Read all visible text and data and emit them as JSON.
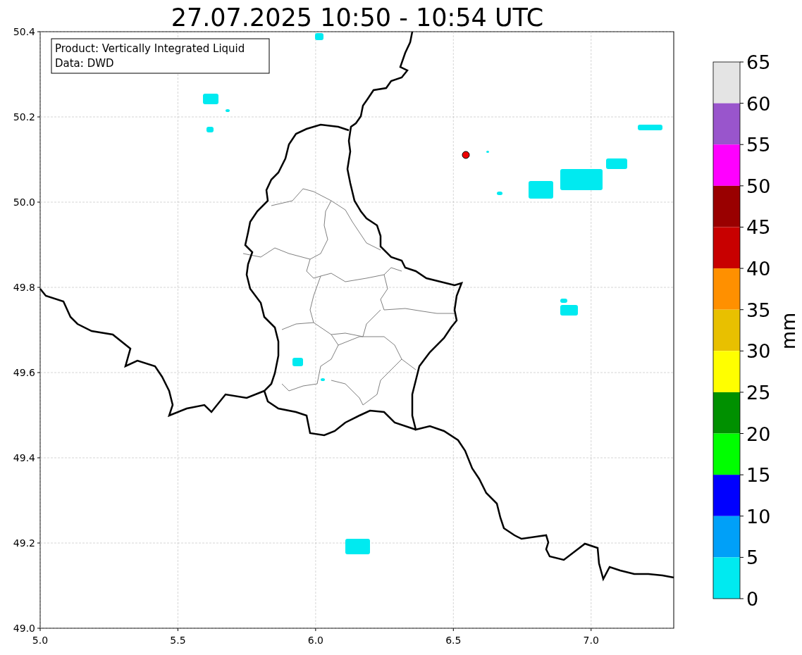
{
  "title": "27.07.2025 10:50 - 10:54 UTC",
  "map": {
    "legend": [
      "Product: Vertically Integrated Liquid",
      "Data: DWD"
    ],
    "xticks": [
      "5.0",
      "5.5",
      "6.0",
      "6.5",
      "7.0"
    ],
    "yticks": [
      "50.4",
      "50.2",
      "50.0",
      "49.8",
      "49.6",
      "49.4",
      "49.2",
      "49.0"
    ]
  },
  "colorbar": {
    "label": "mm",
    "ticks": [
      "65",
      "60",
      "55",
      "50",
      "45",
      "40",
      "35",
      "30",
      "25",
      "20",
      "15",
      "10",
      "5",
      "0"
    ],
    "bins": [
      {
        "color": "#e4e4e4"
      },
      {
        "color": "#9955cc"
      },
      {
        "color": "#ff00ff"
      },
      {
        "color": "#990000"
      },
      {
        "color": "#c80000"
      },
      {
        "color": "#ff9000"
      },
      {
        "color": "#e8c000"
      },
      {
        "color": "#ffff00"
      },
      {
        "color": "#009000"
      },
      {
        "color": "#00ff00"
      },
      {
        "color": "#0000ff"
      },
      {
        "color": "#00a0f8"
      },
      {
        "color": "#00eaf0"
      }
    ]
  }
}
